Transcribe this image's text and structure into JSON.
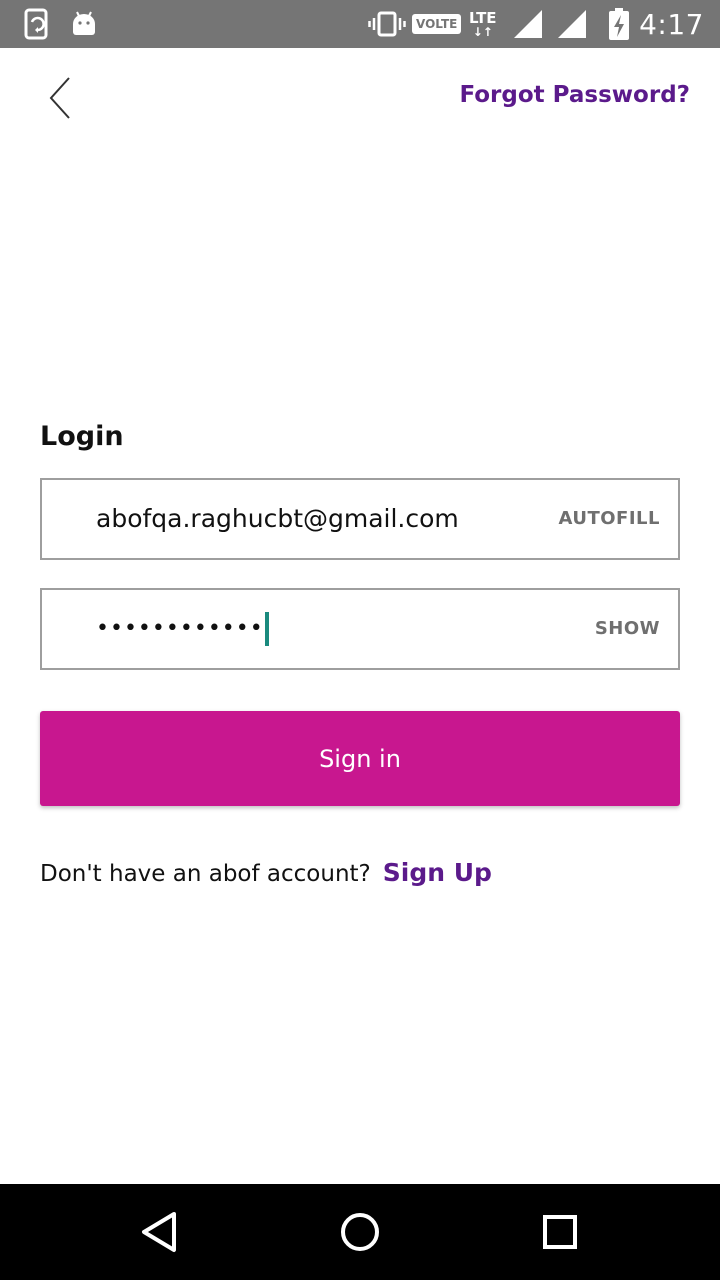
{
  "status_bar": {
    "time": "4:17",
    "volte_label": "VOLTE",
    "lte_label": "LTE",
    "icons": [
      "screen-rotation-icon",
      "android-icon",
      "vibrate-icon",
      "signal-icon",
      "signal-icon",
      "battery-charging-icon"
    ]
  },
  "header": {
    "back_icon": "back-chevron-icon",
    "forgot_password_label": "Forgot Password?"
  },
  "login": {
    "title": "Login",
    "email_value": "abofqa.raghucbt@gmail.com",
    "email_action": "AUTOFILL",
    "password_value": "••••••••••••",
    "password_action": "SHOW",
    "signin_label": "Sign in",
    "signup_prompt": "Don't have an abof account?",
    "signup_link": "Sign Up"
  },
  "nav_bar": {
    "icons": [
      "back-triangle-icon",
      "home-circle-icon",
      "recents-square-icon"
    ]
  },
  "colors": {
    "accent": "#c8178f",
    "link": "#5b1a8b",
    "status_bar": "#757575",
    "caret": "#1a8a7e"
  }
}
